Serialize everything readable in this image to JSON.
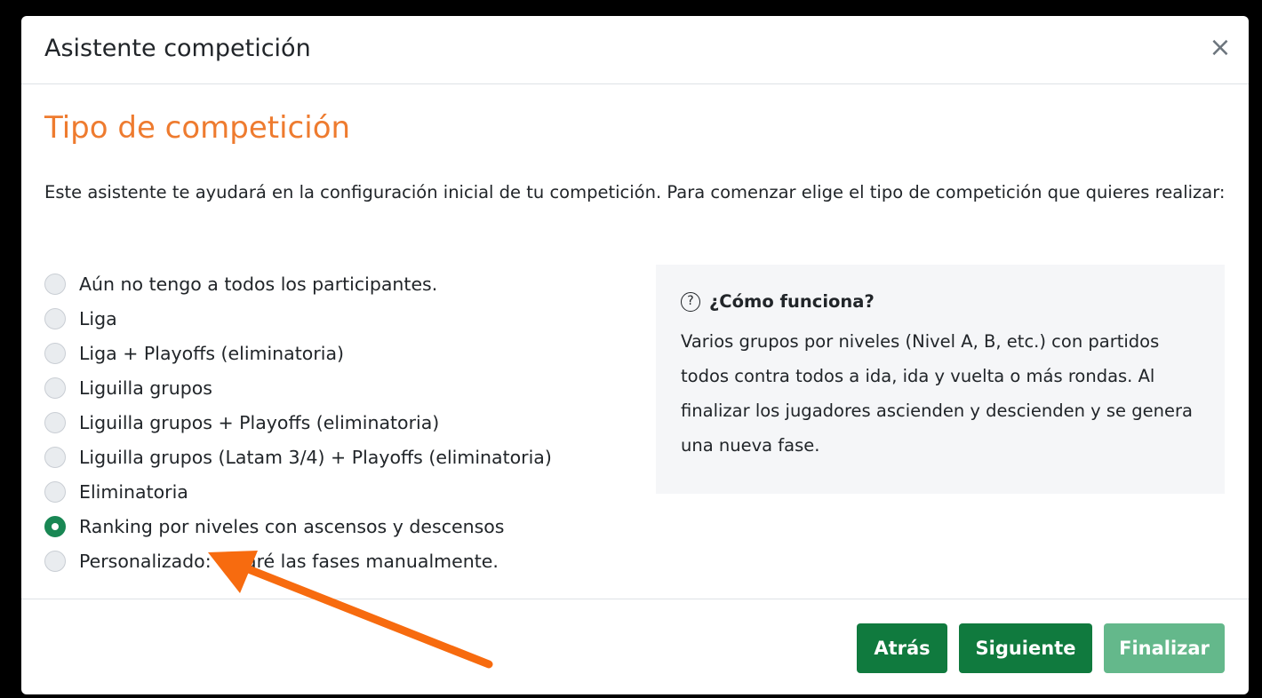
{
  "modal": {
    "title": "Asistente competición",
    "close_label": "×"
  },
  "section_title": "Tipo de competición",
  "intro_text": "Este asistente te ayudará en la configuración inicial de tu competición. Para comenzar elige el tipo de competición que quieres realizar:",
  "options": [
    {
      "label": "Aún no tengo a todos los participantes.",
      "checked": false
    },
    {
      "label": "Liga",
      "checked": false
    },
    {
      "label": "Liga + Playoffs (eliminatoria)",
      "checked": false
    },
    {
      "label": "Liguilla grupos",
      "checked": false
    },
    {
      "label": "Liguilla grupos + Playoffs (eliminatoria)",
      "checked": false
    },
    {
      "label": "Liguilla grupos (Latam 3/4) + Playoffs (eliminatoria)",
      "checked": false
    },
    {
      "label": "Eliminatoria",
      "checked": false
    },
    {
      "label": "Ranking por niveles con ascensos y descensos",
      "checked": true
    },
    {
      "label": "Personalizado: crearé las fases manualmente.",
      "checked": false
    }
  ],
  "info": {
    "icon": "question-circle-icon",
    "title": "¿Cómo funciona?",
    "text": "Varios grupos por niveles (Nivel A, B, etc.) con partidos todos contra todos a ida, ida y vuelta o más rondas. Al finalizar los jugadores ascienden y descienden y se genera una nueva fase."
  },
  "footer": {
    "back_label": "Atrás",
    "next_label": "Siguiente",
    "finish_label": "Finalizar"
  },
  "colors": {
    "accent_title": "#ee7b2f",
    "primary_button": "#107a3e",
    "disabled_button": "#64b88b",
    "annotation_arrow": "#f76b0f"
  }
}
